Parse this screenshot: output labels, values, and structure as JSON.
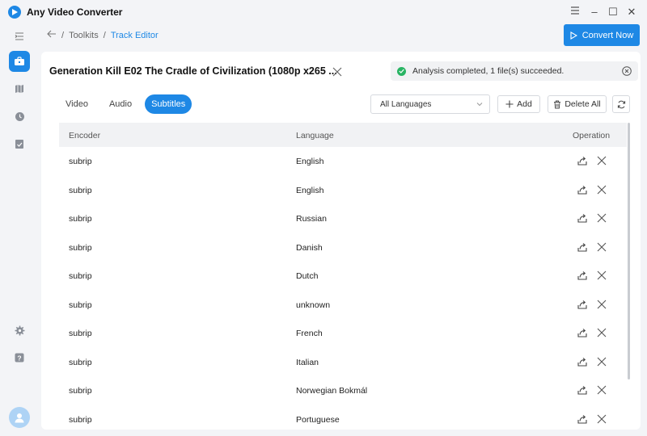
{
  "app": {
    "title": "Any Video Converter"
  },
  "window": {
    "minimize": "–",
    "maximize": "☐",
    "close": "✕"
  },
  "breadcrumb": {
    "root": "Toolkits",
    "sep1": "/",
    "sep2": "/",
    "current": "Track Editor"
  },
  "convert_button": {
    "label": "Convert Now"
  },
  "file": {
    "title": "Generation Kill E02 The Cradle of Civilization (1080p x265 ..."
  },
  "status": {
    "text": "Analysis completed, 1 file(s) succeeded."
  },
  "tabs": [
    {
      "label": "Video"
    },
    {
      "label": "Audio"
    },
    {
      "label": "Subtitles"
    }
  ],
  "active_tab": "Subtitles",
  "language_filter": {
    "selected": "All Languages"
  },
  "toolbar": {
    "add": "Add",
    "delete_all": "Delete All"
  },
  "table": {
    "headers": {
      "encoder": "Encoder",
      "language": "Language",
      "operation": "Operation"
    },
    "rows": [
      {
        "encoder": "subrip",
        "language": "English"
      },
      {
        "encoder": "subrip",
        "language": "English"
      },
      {
        "encoder": "subrip",
        "language": "Russian"
      },
      {
        "encoder": "subrip",
        "language": "Danish"
      },
      {
        "encoder": "subrip",
        "language": "Dutch"
      },
      {
        "encoder": "subrip",
        "language": "unknown"
      },
      {
        "encoder": "subrip",
        "language": "French"
      },
      {
        "encoder": "subrip",
        "language": "Italian"
      },
      {
        "encoder": "subrip",
        "language": "Norwegian Bokmál"
      },
      {
        "encoder": "subrip",
        "language": "Portuguese"
      }
    ]
  },
  "colors": {
    "accent": "#1e88e5",
    "success": "#28b463",
    "background": "#f3f4f7"
  }
}
